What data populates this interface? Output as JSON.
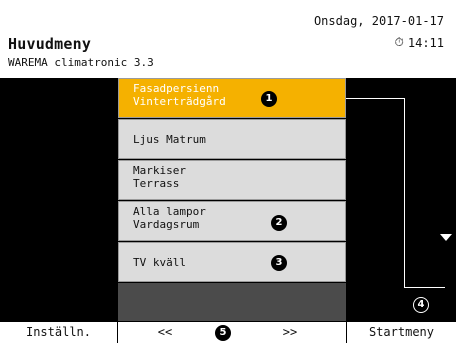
{
  "header": {
    "title": "Huvudmeny",
    "subtitle": "WAREMA climatronic 3.3",
    "date": "Onsdag, 2017-01-17",
    "time": "14:11",
    "time_icon": "clock-icon"
  },
  "menu": {
    "items": [
      {
        "line1": "Fasadpersienn",
        "line2": "Vinterträdgård",
        "badge": "1",
        "selected": true
      },
      {
        "line1": "Ljus Matrum",
        "line2": ""
      },
      {
        "line1": "Markiser",
        "line2": "Terrass"
      },
      {
        "line1": "Alla lampor",
        "line2": "Vardagsrum",
        "badge": "2"
      },
      {
        "line1": "TV kväll",
        "line2": "",
        "badge": "3"
      },
      {
        "line1": "",
        "line2": ""
      }
    ]
  },
  "scroll": {
    "badge": "4",
    "icon": "scroll-down-arrow-icon"
  },
  "footer": {
    "left_label": "Inställn.",
    "prev_label": "<<",
    "page_badge": "5",
    "next_label": ">>",
    "right_label": "Startmeny"
  },
  "colors": {
    "selected": "#f5b100",
    "item": "#dcdcdc",
    "background": "#000000",
    "empty": "#4b4b4b"
  }
}
